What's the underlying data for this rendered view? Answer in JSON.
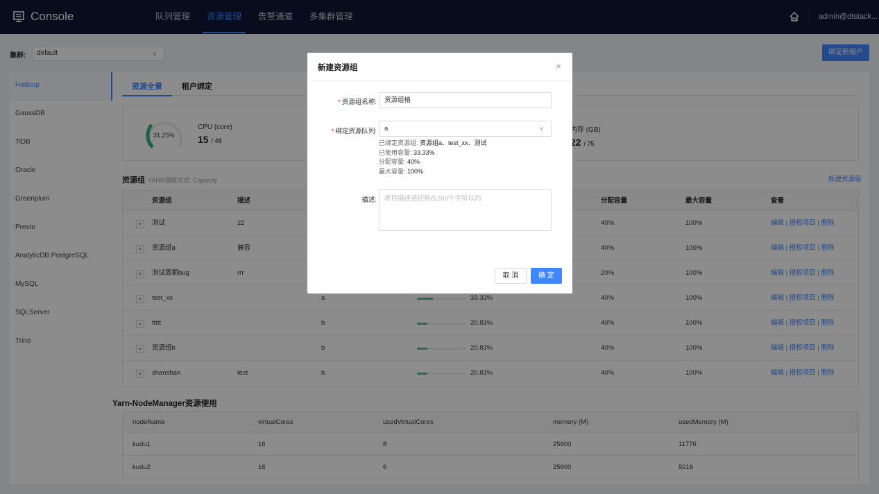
{
  "app": {
    "title": "Console",
    "user": "admin@dtstack..."
  },
  "nav": {
    "tabs": [
      "队列管理",
      "资源管理",
      "告警通道",
      "多集群管理"
    ],
    "active": 1
  },
  "cluster": {
    "label": "集群:",
    "value": "default"
  },
  "bind_tenant_label": "绑定新租户",
  "sidebar": {
    "items": [
      "Hadoop",
      "GaussDB",
      "TiDB",
      "Oracle",
      "Greenplum",
      "Presto",
      "AnalyticDB PostgreSQL",
      "MySQL",
      "SQLServer",
      "Trino"
    ],
    "active": 0
  },
  "sub_tabs": [
    "资源全景",
    "租户绑定"
  ],
  "overview": {
    "gauge_percent": "31.25%",
    "gauge_fraction": 0.3125,
    "cpu": {
      "label": "CPU (core)",
      "used": "15",
      "total": "/ 48"
    },
    "memory": {
      "label": "内存 (GB)",
      "used": "22",
      "total": "/ 75"
    }
  },
  "resource_group": {
    "title": "资源组",
    "mode": "YARN调度方式: Capacity",
    "new_link": "新建资源组",
    "headers": [
      "资源组",
      "描述",
      "分配容量",
      "最大容量",
      "查看"
    ],
    "ops": [
      "编辑 | 授权项目 | 删除"
    ],
    "rows": [
      {
        "plus": "+",
        "name": "测试",
        "desc": "22",
        "queue": "",
        "used": "",
        "used_pct": 0,
        "alloc": "40%",
        "max": "100%",
        "ops": "编辑 | 授权项目 | 删除"
      },
      {
        "plus": "+",
        "name": "资源组a",
        "desc": "兼容",
        "queue": "",
        "used": "",
        "used_pct": 0,
        "alloc": "40%",
        "max": "100%",
        "ops": "编辑 | 授权项目 | 删除"
      },
      {
        "plus": "+",
        "name": "测试周期bug",
        "desc": "rrr",
        "queue": "",
        "used": "",
        "used_pct": 0,
        "alloc": "20%",
        "max": "100%",
        "ops": "编辑 | 授权项目 | 删除"
      },
      {
        "plus": "+",
        "name": "test_xx",
        "desc": "",
        "queue": "a",
        "used": "33.33%",
        "used_pct": 0.3333,
        "alloc": "40%",
        "max": "100%",
        "ops": "编辑 | 授权项目 | 删除"
      },
      {
        "plus": "+",
        "name": "ttttt",
        "desc": "",
        "queue": "b",
        "used": "20.83%",
        "used_pct": 0.2083,
        "alloc": "40%",
        "max": "100%",
        "ops": "编辑 | 授权项目 | 删除"
      },
      {
        "plus": "+",
        "name": "资源组b",
        "desc": "",
        "queue": "b",
        "used": "20.83%",
        "used_pct": 0.2083,
        "alloc": "40%",
        "max": "100%",
        "ops": "编辑 | 授权项目 | 删除"
      },
      {
        "plus": "+",
        "name": "shanshan",
        "desc": "test",
        "queue": "b",
        "used": "20.83%",
        "used_pct": 0.2083,
        "alloc": "40%",
        "max": "100%",
        "ops": "编辑 | 授权项目 | 删除"
      }
    ]
  },
  "yarn": {
    "title": "Yarn-NodeManager资源使用",
    "headers": [
      "nodeName",
      "virtualCores",
      "usedVirtualCores",
      "memory (M)",
      "usedMemory (M)"
    ],
    "rows": [
      [
        "kudu1",
        "16",
        "8",
        "25600",
        "11776"
      ],
      [
        "kudu2",
        "16",
        "6",
        "25600",
        "9216"
      ]
    ]
  },
  "modal": {
    "title": "新建资源组",
    "close": "×",
    "name_label": "资源组名称:",
    "name_value": "资源组格",
    "queue_label": "绑定资源队列:",
    "queue_value": "a",
    "info": [
      {
        "label": "已绑定资源组: ",
        "value": "资源组a、test_xx、测试"
      },
      {
        "label": "已使用容量: ",
        "value": "33.33%"
      },
      {
        "label": "分配容量: ",
        "value": "40%"
      },
      {
        "label": "最大容量: ",
        "value": "100%"
      }
    ],
    "desc_label": "描述:",
    "desc_placeholder": "项目描述请控制在200个字符以内",
    "cancel": "取 消",
    "ok": "确 定",
    "required_mark": "*"
  }
}
